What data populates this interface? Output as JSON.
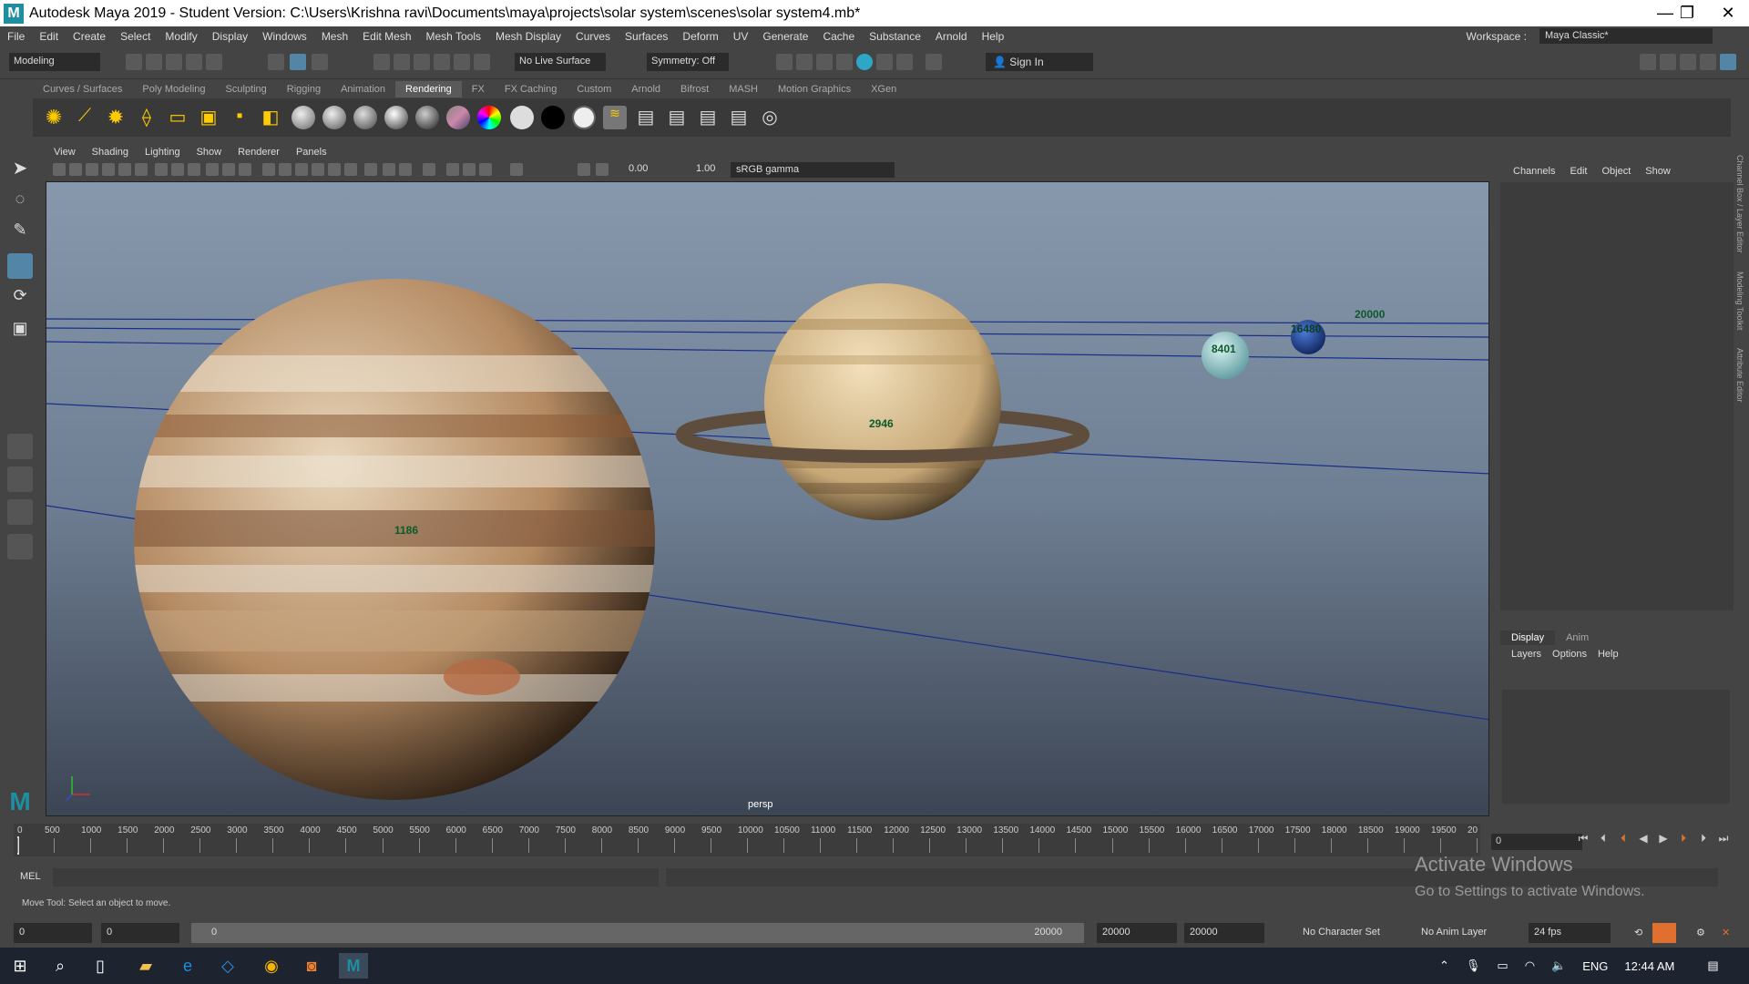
{
  "window": {
    "title": "Autodesk Maya 2019 - Student Version: C:\\Users\\Krishna ravi\\Documents\\maya\\projects\\solar system\\scenes\\solar system4.mb*",
    "minimize": "—",
    "maximize": "❐",
    "close": "✕"
  },
  "menus": [
    "File",
    "Edit",
    "Create",
    "Select",
    "Modify",
    "Display",
    "Windows",
    "Mesh",
    "Edit Mesh",
    "Mesh Tools",
    "Mesh Display",
    "Curves",
    "Surfaces",
    "Deform",
    "UV",
    "Generate",
    "Cache",
    "Substance",
    "Arnold",
    "Help"
  ],
  "workspace": {
    "label": "Workspace :",
    "value": "Maya Classic*"
  },
  "statusline": {
    "mode": "Modeling",
    "live_surface": "No Live Surface",
    "symmetry": "Symmetry: Off",
    "sign_in": "Sign In"
  },
  "shelf_tabs": [
    "Curves / Surfaces",
    "Poly Modeling",
    "Sculpting",
    "Rigging",
    "Animation",
    "Rendering",
    "FX",
    "FX Caching",
    "Custom",
    "Arnold",
    "Bifrost",
    "MASH",
    "Motion Graphics",
    "XGen"
  ],
  "shelf_active": "Rendering",
  "viewport": {
    "menus": [
      "View",
      "Shading",
      "Lighting",
      "Show",
      "Renderer",
      "Panels"
    ],
    "exposure": "0.00",
    "gamma": "1.00",
    "color_space": "sRGB gamma",
    "camera": "persp",
    "labels": {
      "jupiter": "1186",
      "saturn": "2946",
      "uranus": "8401",
      "neptune": "16480",
      "orbit": "20000"
    }
  },
  "channel_box": {
    "menus": [
      "Channels",
      "Edit",
      "Object",
      "Show"
    ],
    "side_tabs": [
      "Channel Box / Layer Editor",
      "Modeling Toolkit",
      "Attribute Editor"
    ]
  },
  "layer_editor": {
    "tabs": [
      "Display",
      "Anim"
    ],
    "menus": [
      "Layers",
      "Options",
      "Help"
    ]
  },
  "timeline": {
    "ticks": [
      "0",
      "500",
      "1000",
      "1500",
      "2000",
      "2500",
      "3000",
      "3500",
      "4000",
      "4500",
      "5000",
      "5500",
      "6000",
      "6500",
      "7000",
      "7500",
      "8000",
      "8500",
      "9000",
      "9500",
      "10000",
      "10500",
      "11000",
      "11500",
      "12000",
      "12500",
      "13000",
      "13500",
      "14000",
      "14500",
      "15000",
      "15500",
      "16000",
      "16500",
      "17000",
      "17500",
      "18000",
      "18500",
      "19000",
      "19500",
      "20"
    ],
    "current": "0",
    "cursor": "0"
  },
  "command_line": {
    "label": "MEL"
  },
  "help_line": "Move Tool: Select an object to move.",
  "activate_windows": {
    "title": "Activate Windows",
    "subtitle": "Go to Settings to activate Windows."
  },
  "range": {
    "start": "0",
    "anim_start": "0",
    "slider_start": "0",
    "slider_end": "20000",
    "anim_end": "20000",
    "end": "20000",
    "character_set": "No Character Set",
    "anim_layer": "No Anim Layer",
    "fps": "24 fps"
  },
  "taskbar": {
    "lang": "ENG",
    "time": "12:44 AM"
  }
}
